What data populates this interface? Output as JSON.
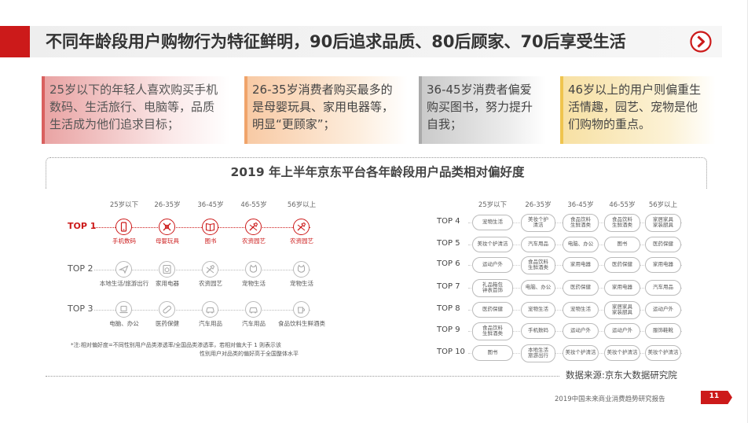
{
  "header": {
    "title": "不同年龄段用户购物行为特征鲜明，90后追求品质、80后顾家、70后享受生活"
  },
  "boxes": [
    {
      "text": "25岁以下的年轻人喜欢购买手机数码、生活旅行、电脑等，品质生活成为他们追求目标；"
    },
    {
      "text": "26-35岁消费者购买最多的是母婴玩具、家用电器等，明显“更顾家”；"
    },
    {
      "text": "36-45岁消费者偏爱购买图书，努力提升自我；"
    },
    {
      "text": "46岁以上的用户则偏重生活情趣，园艺、宠物是他们购物的重点。"
    }
  ],
  "chart": {
    "title": "2019 年上半年京东平台各年龄段用户品类相对偏好度",
    "age_groups": [
      "25岁以下",
      "26-35岁",
      "36-45岁",
      "46-55岁",
      "56岁以上"
    ],
    "left_ranks": [
      {
        "rank": "TOP 1",
        "items": [
          {
            "label": "手机数码",
            "icon": "phone-icon"
          },
          {
            "label": "母婴玩具",
            "icon": "baby-bottle-icon"
          },
          {
            "label": "图书",
            "icon": "book-icon"
          },
          {
            "label": "农资园艺",
            "icon": "shovel-icon"
          },
          {
            "label": "农资园艺",
            "icon": "shovel-icon"
          }
        ]
      },
      {
        "rank": "TOP 2",
        "items": [
          {
            "label": "本地生活/旅游出行",
            "icon": "plane-icon"
          },
          {
            "label": "家用电器",
            "icon": "washer-icon"
          },
          {
            "label": "农资园艺",
            "icon": "shovel-icon"
          },
          {
            "label": "宠物生活",
            "icon": "cat-icon"
          },
          {
            "label": "宠物生活",
            "icon": "cat-icon"
          }
        ]
      },
      {
        "rank": "TOP 3",
        "items": [
          {
            "label": "电脑、办公",
            "icon": "laptop-icon"
          },
          {
            "label": "医药保健",
            "icon": "pill-icon"
          },
          {
            "label": "汽车用品",
            "icon": "car-icon"
          },
          {
            "label": "汽车用品",
            "icon": "car-icon"
          },
          {
            "label": "食品饮料生鲜酒类",
            "icon": "cup-icon"
          }
        ]
      }
    ],
    "note_line1": "*注:相对偏好度=不同性别用户品类渗透率/全国品类渗透率，若相对偏大于 1 则表示该",
    "note_line2": "性别用户对品类的偏好高于全国整体水平",
    "right_ranks": [
      {
        "rank": "TOP 4",
        "items": [
          "宠物生活",
          "美妆个护\n清洁",
          "食品饮料\n生鲜酒类",
          "食品饮料\n生鲜酒类",
          "家居家具\n家装厨具"
        ]
      },
      {
        "rank": "TOP 5",
        "items": [
          "美妆个护清洁",
          "汽车用品",
          "电脑、办公",
          "图书",
          "医药保健"
        ]
      },
      {
        "rank": "TOP 6",
        "items": [
          "运动户外",
          "食品饮料\n生鲜酒类",
          "家用电器",
          "医药保健",
          "家用电器"
        ]
      },
      {
        "rank": "TOP 7",
        "items": [
          "礼品箱包\n钟表首饰",
          "电脑、办公",
          "医药保健",
          "家用电器",
          "汽车用品"
        ]
      },
      {
        "rank": "TOP 8",
        "items": [
          "医药保健",
          "宠物生活",
          "宠物生活",
          "家居家具\n家装厨具",
          "运动户外"
        ]
      },
      {
        "rank": "TOP 9",
        "items": [
          "食品饮料\n生鲜酒类",
          "手机数码",
          "运动户外",
          "运动户外",
          "服饰鞋靴"
        ]
      },
      {
        "rank": "TOP 10",
        "items": [
          "图书",
          "本地生活\n旅游出行",
          "美妆个护清洁",
          "美妆个护清洁",
          "美妆个护清洁"
        ]
      }
    ]
  },
  "footer": {
    "source": "数据来源:京东大数据研究院",
    "report": "2019中国未来商业消费趋势研究报告",
    "page": "11"
  },
  "colors": {
    "accent": "#cc1a1a"
  }
}
